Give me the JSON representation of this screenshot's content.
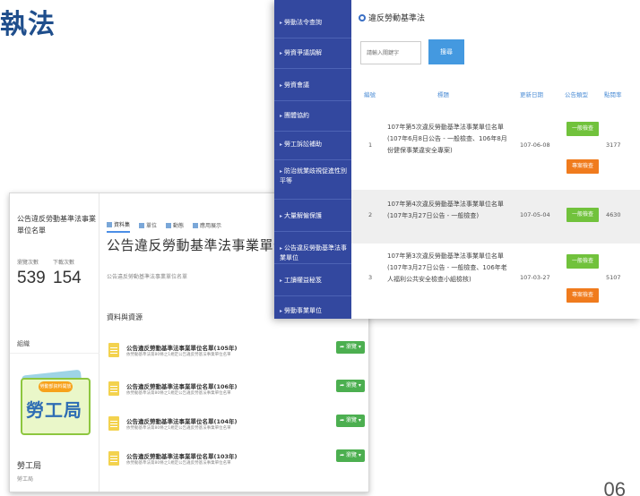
{
  "slide": {
    "title": "執法",
    "page_number": "06"
  },
  "portal": {
    "dataset_name": "公告違反勞動基準法事業單位名單",
    "stats": [
      {
        "label": "瀏覽次數",
        "value": "539"
      },
      {
        "label": "下載次數",
        "value": "154"
      }
    ],
    "org_section_label": "組織",
    "org_logo": {
      "badge": "勞動部資料開放",
      "text": "勞工局"
    },
    "org_name": "勞工局",
    "org_sub": "勞工局",
    "tabs": [
      "資料集",
      "單位",
      "動態",
      "應用展示"
    ],
    "title": "公告違反勞動基準法事業單位名單",
    "subtitle": "公告違反勞動基準法事業單位名單",
    "resources_heading": "資料與資源",
    "resources": [
      {
        "title": "公告違反勞動基準法事業單位名單(105年)",
        "desc": "依勞動基準法第80條之1規定公告違反勞基法事業單位名單",
        "button": "瀏覽"
      },
      {
        "title": "公告違反勞動基準法事業單位名單(106年)",
        "desc": "依勞動基準法第80條之1規定公告違反勞基法事業單位名單",
        "button": "瀏覽"
      },
      {
        "title": "公告違反勞動基準法事業單位名單(104年)",
        "desc": "依勞動基準法第80條之1規定公告違反勞基法事業單位名單",
        "button": "瀏覽"
      },
      {
        "title": "公告違反勞動基準法事業單位名單(103年)",
        "desc": "依勞動基準法第80條之1規定公告違反勞基法事業單位名單",
        "button": "瀏覽"
      }
    ]
  },
  "labor_site": {
    "nav": [
      "勞動法令查詢",
      "勞資爭議調解",
      "勞資會議",
      "團體協約",
      "勞工訴訟補助",
      "防治就業歧視促進性別平等",
      "大量解僱保護",
      "公告違反勞動基準法事業單位",
      "工讀權益秘笈",
      "勞動事業單位"
    ],
    "section_title": "違反勞動基準法",
    "search": {
      "placeholder": "請輸入關鍵字",
      "button": "搜尋"
    },
    "table_headers": [
      "編號",
      "標題",
      "更新日期",
      "公告類型",
      "點閱率"
    ],
    "rows": [
      {
        "no": "1",
        "title": "107年第5次違反勞動基準法事業單位名單(107年6月8日公告 - 一般檢查、106年8月份健保事業違安全專案)",
        "date": "107-06-08",
        "tags": [
          "一般檢查",
          "專案檢查"
        ],
        "views": "3177"
      },
      {
        "no": "2",
        "title": "107年第4次違反勞動基準法事業單位名單(107年3月27日公告 - 一般檢查)",
        "date": "107-05-04",
        "tags": [
          "一般檢查"
        ],
        "views": "4630"
      },
      {
        "no": "3",
        "title": "107年第3次違反勞動基準法事業單位名單(107年3月27日公告 - 一般檢查、106年老人福利公共安全檢查小組檢核)",
        "date": "107-03-27",
        "tags": [
          "一般檢查",
          "專案檢查"
        ],
        "views": "5107"
      }
    ]
  },
  "colors": {
    "nav_bg": "#33489f",
    "tag_general": "#71c23c",
    "tag_special": "#f07b1d",
    "search_button": "#4499e0",
    "title_blue": "#1f4e8c"
  }
}
